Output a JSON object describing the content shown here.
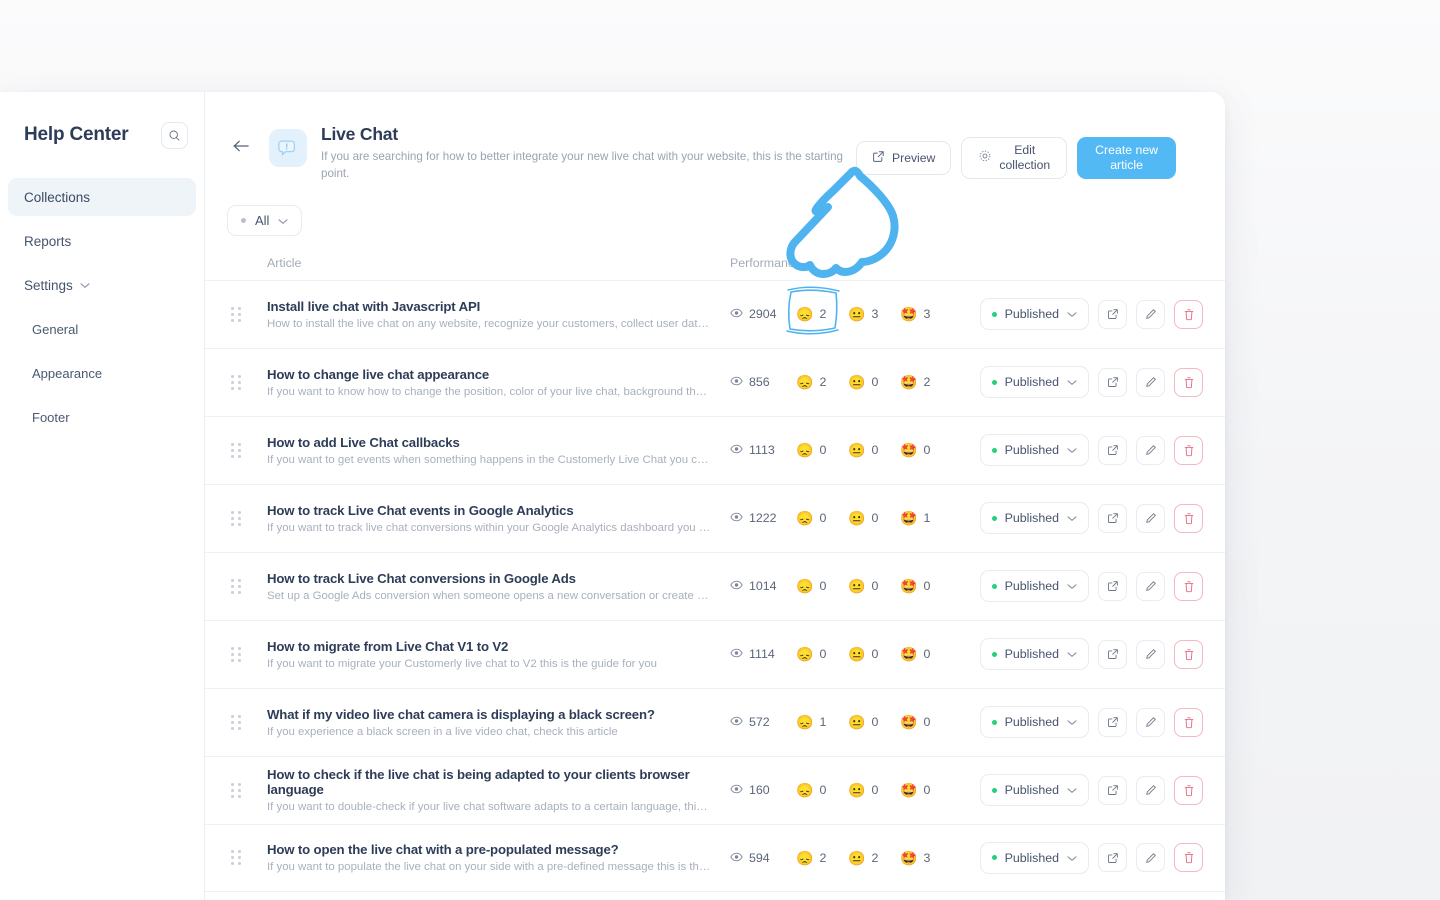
{
  "sidebar": {
    "title": "Help Center",
    "search_icon": "search-icon",
    "items": [
      {
        "label": "Collections",
        "active": true,
        "sub": false,
        "chevron": false
      },
      {
        "label": "Reports",
        "active": false,
        "sub": false,
        "chevron": false
      },
      {
        "label": "Settings",
        "active": false,
        "sub": false,
        "chevron": true
      },
      {
        "label": "General",
        "active": false,
        "sub": true,
        "chevron": false
      },
      {
        "label": "Appearance",
        "active": false,
        "sub": true,
        "chevron": false
      },
      {
        "label": "Footer",
        "active": false,
        "sub": true,
        "chevron": false
      }
    ]
  },
  "header": {
    "back_icon": "arrow-left-icon",
    "collection_icon": "chat-bubble-icon",
    "title": "Live Chat",
    "subtitle": "If you are searching for how to better integrate your new live chat with your website, this is the starting point.",
    "preview_label": "Preview",
    "preview_icon": "external-link-icon",
    "edit_label_line1": "Edit",
    "edit_label_line2": "collection",
    "edit_icon": "gear-icon",
    "create_label_line1": "Create new",
    "create_label_line2": "article",
    "accent_color": "#52b9f5"
  },
  "filter": {
    "label": "All",
    "chevron_icon": "chevron-down-icon"
  },
  "table": {
    "columns": {
      "article": "Article",
      "performance": "Performance"
    },
    "status_label": "Published",
    "status_color": "#25d07d",
    "emoji": {
      "sad": "😞",
      "neutral": "😐",
      "love": "🤩"
    },
    "icons": {
      "views": "eye-icon",
      "open": "external-link-icon",
      "edit": "pencil-icon",
      "delete": "trash-icon",
      "drag": "drag-handle-icon",
      "status_chevron": "chevron-down-icon"
    },
    "rows": [
      {
        "title": "Install live chat with Javascript API",
        "subtitle": "How to install the live chat on any website, recognize your customers, collect user data and …",
        "views": "2904",
        "sad": "2",
        "neutral": "3",
        "love": "3",
        "status": "Published"
      },
      {
        "title": "How to change live chat appearance",
        "subtitle": "If you want to know how to change the position, color of your live chat, background theme an…",
        "views": "856",
        "sad": "2",
        "neutral": "0",
        "love": "2",
        "status": "Published"
      },
      {
        "title": "How to add Live Chat callbacks",
        "subtitle": "If you want to get events when something happens in the Customerly Live Chat you can use …",
        "views": "1113",
        "sad": "0",
        "neutral": "0",
        "love": "0",
        "status": "Published"
      },
      {
        "title": "How to track Live Chat events in Google Analytics",
        "subtitle": "If you want to track live chat conversions within your Google Analytics dashboard you can fol…",
        "views": "1222",
        "sad": "0",
        "neutral": "0",
        "love": "1",
        "status": "Published"
      },
      {
        "title": "How to track Live Chat conversions in Google Ads",
        "subtitle": "Set up a Google Ads conversion when someone opens a new conversation or create a new l…",
        "views": "1014",
        "sad": "0",
        "neutral": "0",
        "love": "0",
        "status": "Published"
      },
      {
        "title": "How to migrate from Live Chat V1 to V2",
        "subtitle": "If you want to migrate your Customerly live chat to V2 this is the guide for you",
        "views": "1114",
        "sad": "0",
        "neutral": "0",
        "love": "0",
        "status": "Published"
      },
      {
        "title": "What if my video live chat camera is displaying a black screen?",
        "subtitle": "If you experience a black screen in a live video chat, check this article",
        "views": "572",
        "sad": "1",
        "neutral": "0",
        "love": "0",
        "status": "Published"
      },
      {
        "title": "How to check if the live chat is being adapted to your clients browser language",
        "subtitle": "If you want to double-check if your live chat software adapts to a certain language, this articl…",
        "views": "160",
        "sad": "0",
        "neutral": "0",
        "love": "0",
        "status": "Published"
      },
      {
        "title": "How to open the live chat with a pre-populated message?",
        "subtitle": "If you want to populate the live chat on your side with a pre-defined message this is thee righ…",
        "views": "594",
        "sad": "2",
        "neutral": "2",
        "love": "3",
        "status": "Published"
      }
    ]
  },
  "annotation": {
    "cursor_icon": "pointing-hand-cursor",
    "highlight_icon": "hand-drawn-highlight-box",
    "color": "#4FB3F0"
  }
}
